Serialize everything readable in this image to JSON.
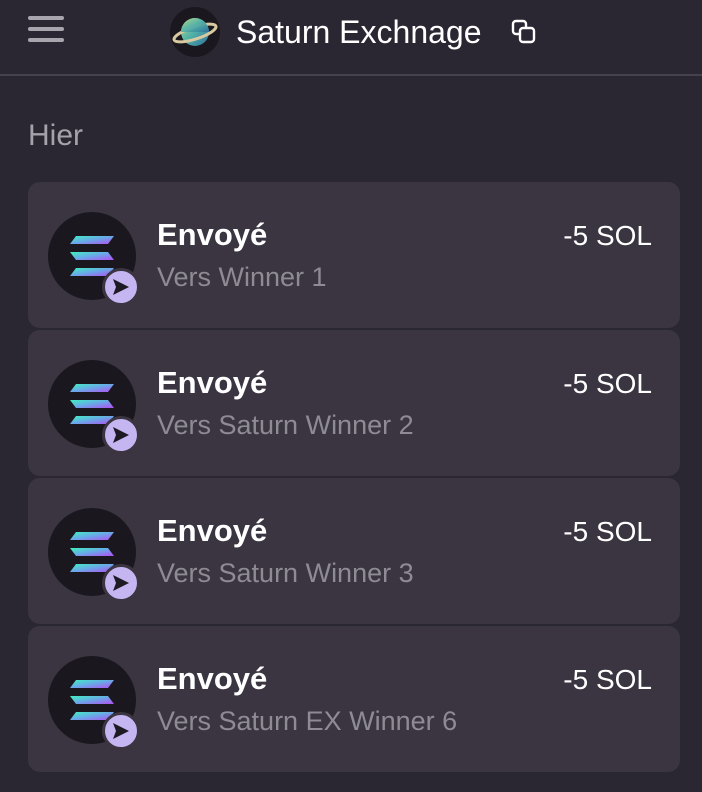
{
  "header": {
    "title": "Saturn Exchnage",
    "logo_icon": "saturn-planet-icon",
    "menu_icon": "hamburger-menu-icon",
    "copy_icon": "copy-icon"
  },
  "section": {
    "label": "Hier"
  },
  "transactions": [
    {
      "title": "Envoyé",
      "subtitle": "Vers Winner 1",
      "amount": "-5 SOL",
      "icon": "solana-icon",
      "badge_icon": "send-arrow-icon"
    },
    {
      "title": "Envoyé",
      "subtitle": "Vers Saturn Winner 2",
      "amount": "-5 SOL",
      "icon": "solana-icon",
      "badge_icon": "send-arrow-icon"
    },
    {
      "title": "Envoyé",
      "subtitle": "Vers Saturn Winner 3",
      "amount": "-5 SOL",
      "icon": "solana-icon",
      "badge_icon": "send-arrow-icon"
    },
    {
      "title": "Envoyé",
      "subtitle": "Vers Saturn EX Winner 6",
      "amount": "-5 SOL",
      "icon": "solana-icon",
      "badge_icon": "send-arrow-icon"
    }
  ],
  "colors": {
    "background": "#2b2732",
    "card": "#3a3541",
    "badge": "#c5b6f2",
    "muted_text": "#8f8b95"
  }
}
